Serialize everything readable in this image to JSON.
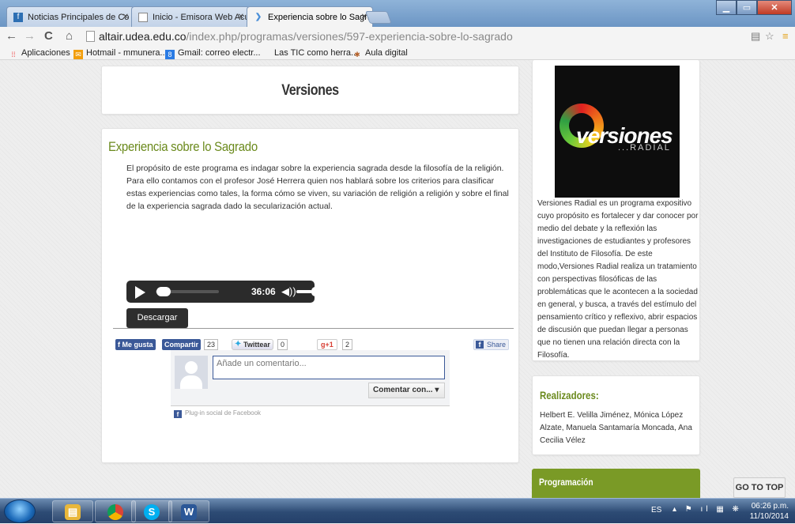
{
  "browser": {
    "tabs": [
      {
        "label": "Noticias Principales de Co",
        "icon": "f-icon"
      },
      {
        "label": "Inicio - Emisora Web Acú",
        "icon": "page-icon"
      },
      {
        "label": "Experiencia sobre lo Sagra",
        "icon": "chevron-icon"
      }
    ],
    "url_host": "altair.udea.edu.co",
    "url_path": "/index.php/programas/versiones/597-experiencia-sobre-lo-sagrado",
    "bookmarks": [
      {
        "label": "Aplicaciones",
        "icon": "apps-grid-icon",
        "color": "#e33"
      },
      {
        "label": "Hotmail - mmunera...",
        "icon": "hotmail-icon",
        "color": "#f29e0c"
      },
      {
        "label": "Gmail: correo electr...",
        "icon": "gmail-icon",
        "color": "#2a7be4"
      },
      {
        "label": "Las TIC como herra...",
        "icon": "blank-page-icon",
        "color": "#ccc"
      },
      {
        "label": "Aula digital",
        "icon": "aula-icon",
        "color": "#b4612a"
      }
    ]
  },
  "page": {
    "section_title": "Versiones",
    "article": {
      "title": "Experiencia sobre lo Sagrado",
      "description": "El propósito de este programa es indagar sobre la experiencia sagrada desde la filosofía de la religión. Para ello contamos con el profesor José Herrera quien nos hablará sobre los criterios para clasificar estas experiencias como tales, la forma cómo se viven, su variación de religión a religión y sobre el final de la experiencia sagrada dado la secularización actual.",
      "player": {
        "time": "36:06"
      },
      "download_label": "Descargar"
    },
    "social": {
      "like_label": "Me gusta",
      "share_label": "Compartir",
      "share_count": "23",
      "tweet_label": "Twittear",
      "tweet_count": "0",
      "gplus_label": "+1",
      "gplus_count": "2",
      "fb_share_label": "Share"
    },
    "comments": {
      "placeholder": "Añade un comentario...",
      "comment_with": "Comentar con...",
      "plugin_label": "Plug-in social de Facebook"
    },
    "sidebar": {
      "logo_word": "versiones",
      "logo_sub": "...RADIAL",
      "description": "Versiones Radial es un programa expositivo cuyo propósito es fortalecer y dar conocer por medio del debate y la reflexión las investigaciones de estudiantes y profesores del Instituto de Filosofía. De este modo,Versiones Radial realiza un tratamiento con perspectivas filosóficas de las problemáticas que le acontecen a la sociedad en general, y busca, a través del estímulo del pensamiento crítico y reflexivo, abrir espacios de discusión que puedan llegar a personas que no tienen una relación directa con la Filosofía.",
      "credits_title": "Realizadores:",
      "credits_text": "Helbert E. Velilla Jiménez, Mónica López Alzate, Manuela Santamaría Moncada, Ana Cecilia Vélez",
      "programming_title": "Programación"
    },
    "go_top": "GO TO TOP"
  },
  "taskbar": {
    "apps": [
      "explorer-icon",
      "chrome-icon",
      "skype-icon",
      "word-icon"
    ],
    "lang": "ES",
    "time": "06:26 p.m.",
    "date": "11/10/2014"
  },
  "colors": {
    "accent_green": "#6b8a1d",
    "facebook_blue": "#3b5998"
  }
}
